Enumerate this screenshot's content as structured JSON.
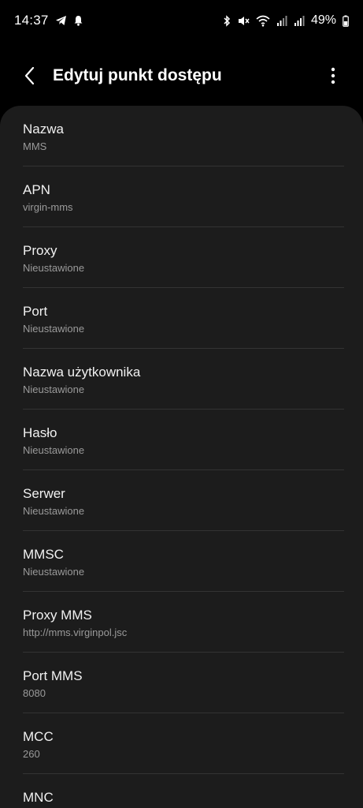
{
  "status_bar": {
    "time": "14:37",
    "battery": "49%",
    "left_icons": [
      "telegram-icon",
      "bell-icon"
    ],
    "right_icons": [
      "bluetooth-icon",
      "mute-icon",
      "wifi-icon",
      "signal-icon",
      "signal-icon",
      "battery-icon"
    ]
  },
  "header": {
    "title": "Edytuj punkt dostępu"
  },
  "fields": [
    {
      "label": "Nazwa",
      "value": "MMS"
    },
    {
      "label": "APN",
      "value": "virgin-mms"
    },
    {
      "label": "Proxy",
      "value": "Nieustawione"
    },
    {
      "label": "Port",
      "value": "Nieustawione"
    },
    {
      "label": "Nazwa użytkownika",
      "value": "Nieustawione"
    },
    {
      "label": "Hasło",
      "value": "Nieustawione"
    },
    {
      "label": "Serwer",
      "value": "Nieustawione"
    },
    {
      "label": "MMSC",
      "value": "Nieustawione"
    },
    {
      "label": "Proxy MMS",
      "value": "http://mms.virginpol.jsc"
    },
    {
      "label": "Port MMS",
      "value": "8080"
    },
    {
      "label": "MCC",
      "value": "260"
    },
    {
      "label": "MNC",
      "value": ""
    }
  ],
  "colors": {
    "background": "#000000",
    "card": "#1c1c1c",
    "label": "#f1f1f1",
    "value": "#9a9a9a",
    "divider": "#333333"
  }
}
